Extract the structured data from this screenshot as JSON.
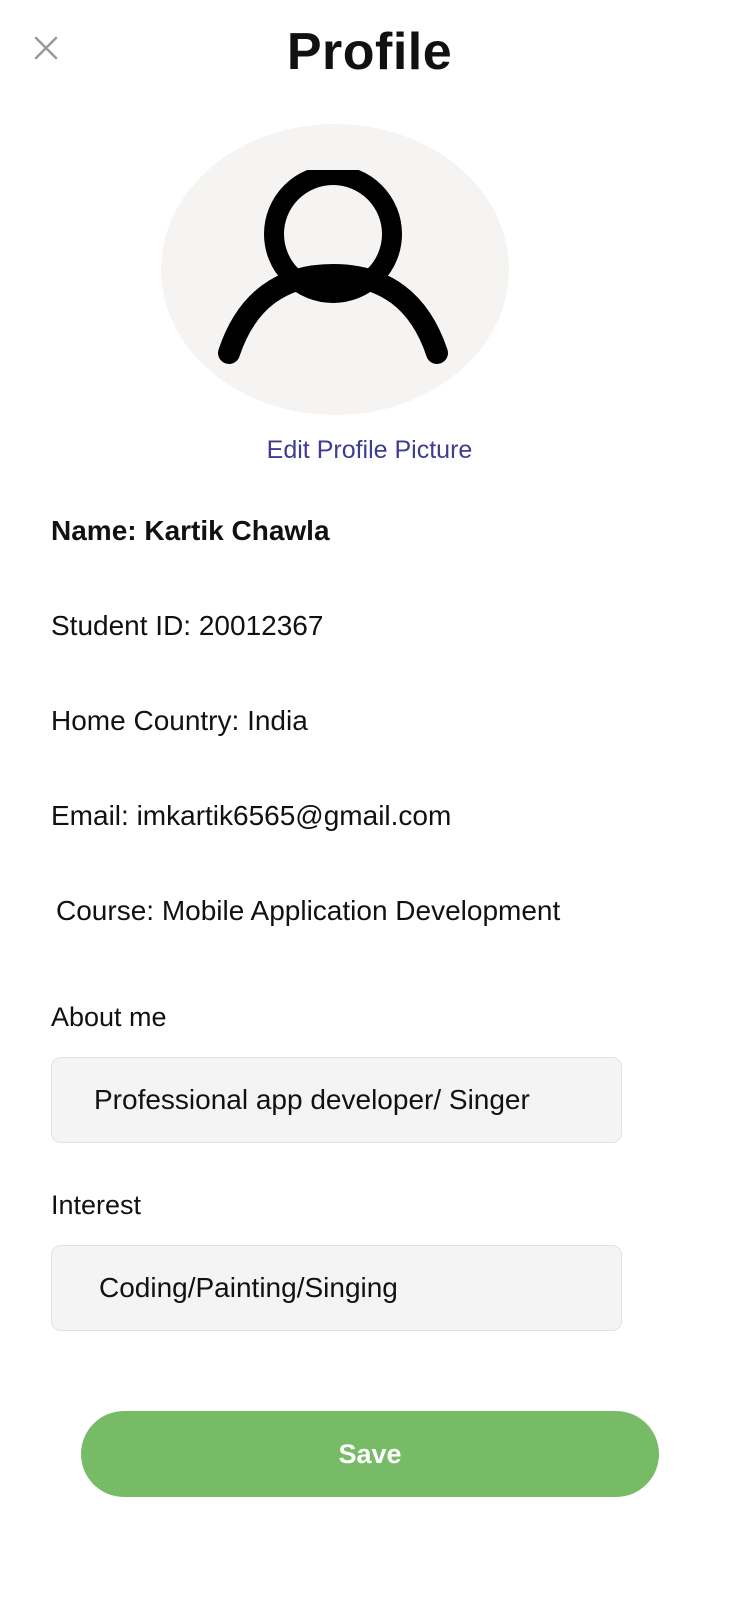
{
  "header": {
    "title": "Profile",
    "close_icon": "close-icon"
  },
  "avatar": {
    "icon": "user-icon",
    "background": "#f5f4f2",
    "edit_label": "Edit Profile Picture"
  },
  "info": {
    "name": "Name: Kartik Chawla",
    "student_id": "Student ID: 20012367",
    "home_country": "Home Country: India",
    "email": "Email: imkartik6565@gmail.com",
    "course": "Course: Mobile Application Development"
  },
  "about": {
    "label": "About me",
    "value": "Professional app developer/ Singer"
  },
  "interest": {
    "label": "Interest",
    "value": "Coding/Painting/Singing"
  },
  "actions": {
    "save_label": "Save"
  },
  "colors": {
    "accent": "#77bb66",
    "link": "#3f3d8f",
    "field_background": "#f4f4f4"
  }
}
